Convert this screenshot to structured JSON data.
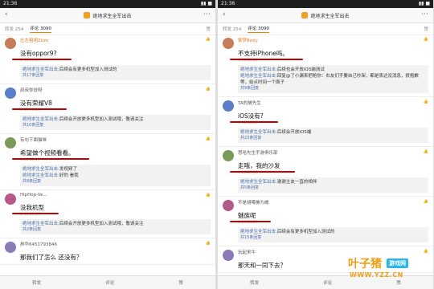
{
  "status": {
    "time": "21:36"
  },
  "title": "绝地求生全军出击",
  "tabs": {
    "repost": "转发 254",
    "comment": "评论 3090",
    "like": "赞"
  },
  "bottom": {
    "repost": "转发",
    "comment": "评论",
    "like": "赞"
  },
  "left": {
    "comments": [
      {
        "name": "左左祖祖Zozo",
        "text": "没有oppor9?",
        "meta": "1-10 13:16",
        "replies": [
          {
            "n": "绝地求生全军出击:",
            "t": "后续会有更多机型加入测试的"
          }
        ],
        "more": "共17条回复"
      },
      {
        "name": "叔叔你说呀",
        "text": "没有荣耀V8",
        "meta": "1-10 13:14",
        "replies": [
          {
            "n": "绝地求生全军出击:",
            "t": "后续会开放更多机型加入测试哦，敬请关注"
          }
        ],
        "more": "共10条回复"
      },
      {
        "name": "有句下面猫咪",
        "text": "希望做个视频看看。",
        "meta": "1-10 13:17",
        "replies": [
          {
            "n": "绝地求生全军出击:",
            "t": "发视频了"
          },
          {
            "n": "绝地求生全军出击:",
            "t": "好的 看我"
          }
        ],
        "more": "共8条回复"
      },
      {
        "name": "HipHop-Ve...",
        "text": "没我机型",
        "meta": "1-10 13:17",
        "replies": [
          {
            "n": "绝地求生全军出击:",
            "t": "后续会开放更多机型加入测试哦，敬请关注"
          }
        ],
        "more": "共2条回复"
      },
      {
        "name": "林华6451793846",
        "text": "那我们了怎么 还没有？",
        "meta": "",
        "replies": [],
        "more": ""
      }
    ]
  },
  "right": {
    "comments": [
      {
        "name": "紫梦Body",
        "text": "不支持iPhone吗。",
        "meta": "1-10 13:16",
        "replies": [
          {
            "n": "绝地求生全军出击:",
            "t": "后续也会开放iOS端测试"
          },
          {
            "n": "绝地求生全军出击:",
            "t": "回复@了小漏来把枪你：右友们手要自己吵架，都是表达没消息，很抱歉等，给点时间一个面子"
          }
        ],
        "more": "共9条回复"
      },
      {
        "name": "TA的摊先生",
        "text": "iOS没有?",
        "meta": "1-10 13:16",
        "replies": [
          {
            "n": "绝地求生全军出击:",
            "t": "后续会开放iOS端"
          }
        ],
        "more": "共23条回复"
      },
      {
        "name": "思哈先生手游俱乐部",
        "text": "走哦，我的沙发",
        "meta": "1-10 13:13",
        "replies": [
          {
            "n": "绝地求生全军出击:",
            "t": "谢谢主友一直的相伴"
          }
        ],
        "more": "共5条回复"
      },
      {
        "name": "不是胡噶佛为威",
        "text": "魅族呢",
        "meta": "1-10 13:17",
        "replies": [
          {
            "n": "绝地求生全军出击:",
            "t": "后续会有更多机型加入测试的"
          }
        ],
        "more": "共15条回复"
      },
      {
        "name": "玩起来牛",
        "text": "那天和一同下去？",
        "meta": "",
        "replies": [],
        "more": ""
      }
    ]
  },
  "watermark": {
    "big": "叶子猪",
    "small": "游戏网",
    "url": "WWW.YZZ.CN"
  }
}
